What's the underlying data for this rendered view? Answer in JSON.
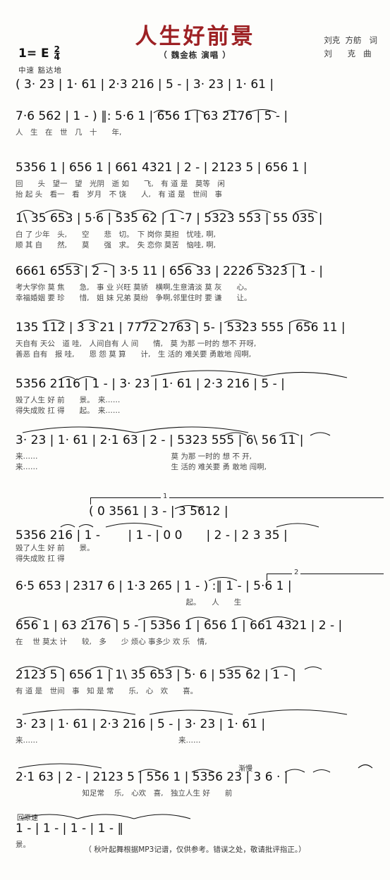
{
  "header": {
    "title": "人生好前景",
    "singer": "（ 魏金栋 演唱 ）",
    "lyricist_row": "刘克  方舫   词",
    "composer_row": "刘      克   曲",
    "key": "1= E",
    "meter_num": "2",
    "meter_den": "4",
    "tempo": "中速 豁达地",
    "title_color": "#9d2124"
  },
  "markings": {
    "rit": "渐慢",
    "a_tempo": "回原速",
    "ending1": "1",
    "ending2": "2"
  },
  "lines": [
    {
      "id": "line-1",
      "notes": "( 3· 23 | 1· 61 | 2·3 216 | 5 - | 3· 23 | 1· 61 |",
      "lyrics": []
    },
    {
      "id": "line-2",
      "notes": "7·6 562 | 1 - ) ‖: 5·6 1 | 656 1 | 63 2176 | 5 - |",
      "lyrics": [
        "人　生　在　世　几　十　　年,"
      ]
    },
    {
      "id": "line-3",
      "notes": "5356 1 | 656 1 | 661 4321 | 2 - | 2123 5 | 656 1 |",
      "lyrics": [
        "回　　头　望一　望　光阴　逝 如　　飞,　有 道 是　莫等　闲",
        "抬 起 头　看一　看　岁月　不 饶　　人,　有 道 是　世间　事"
      ]
    },
    {
      "id": "line-4",
      "notes": "1\\ 35 653 | 5·6 | 535 62 | 1 -7 | 5323 553 | 55 035 |",
      "lyrics": [
        "白 了 少年　头,　　空　　悲　切。　下 岗你 莫担　忧哇, 啊,",
        "顺 其 自　　然,　　莫　　强　求。　失 恋你 莫苦　恼哇, 啊,"
      ]
    },
    {
      "id": "line-5",
      "notes": "6661 6553 | 2 - | 3·5 11 | 656 33 | 2226 5323 | 1 - |",
      "lyrics": [
        "考大学你 莫 焦　　急,　事 业 兴旺 莫骄　横啊,生意清淡 莫 灰　　心。",
        "幸福婚姻 要 珍　　惜,　姐 妹 兄弟 莫纷　争啊,邻里住时 要 谦　　让。"
      ]
    },
    {
      "id": "line-6",
      "notes": "135 112 | 3 3 21 | 7772 2763 | 5- | 5323 555 | 656 11 |",
      "lyrics": [
        "天自有 天公　道 哇,　人间自有 人 间　　情,　莫 为那 一时的 想不 开呀,",
        "善恶 自有　报 哇,　　恩 怨 莫 算　　计,　生 活的 难关要 勇敢地 闯啊,"
      ]
    },
    {
      "id": "line-7",
      "notes": "5356 2116 | 1 - | 3· 23 | 1· 61 | 2·3 216 | 5 - |",
      "lyrics": [
        "毁了人生 好 前　　景。　来……",
        "得失成败 扛 得　　起。　来……"
      ]
    },
    {
      "id": "line-8",
      "notes": "3· 23 | 1· 61 | 2·1 63 | 2 - | 5323 555 | 6\\ 56 11 |",
      "lyrics": [
        "来……　　　　　　　　　　　　　　　　　　莫 为那 一时的 想 不 开,",
        "来……　　　　　　　　　　　　　　　　　　生 活的 难关要 勇 敢地 闯啊,"
      ]
    },
    {
      "id": "line-9-upper",
      "notes": "( 0 3561 | 3 - | 3 5612 |",
      "lyrics": []
    },
    {
      "id": "line-9",
      "notes": "5356 216 | 1 -　　 | 1 - | 0 0　　| 2 - | 2 3 35 |",
      "lyrics": [
        "毁了人生 好 前　　景。",
        "得失成败 扛 得"
      ]
    },
    {
      "id": "line-10",
      "notes": "6·5 653 | 2317 6 | 1·3 265 | 1 - ) :‖ 1 - | 5·6 1 |",
      "lyrics": [
        "　　　　　　　　　　　　　　　　　　　　　　　起。　　人　　生"
      ]
    },
    {
      "id": "line-11",
      "notes": "656 1 | 63 2176 | 5 - | 5356 1 | 656 1 | 661 4321 | 2 - |",
      "lyrics": [
        "在　 世 莫太 计　　较,　多　　少 烦心 事多少 欢 乐　情,"
      ]
    },
    {
      "id": "line-12",
      "notes": "2123 5 | 656 1 | 1\\ 35 653 | 5· 6 | 535 62 | 1 - |",
      "lyrics": [
        "有 道 是　世间　事　知 是 常　　乐,　心　欢　　喜。"
      ]
    },
    {
      "id": "line-13",
      "notes": "3· 23 | 1· 61 | 2·3 216 | 5 - | 3· 23 | 1· 61 |",
      "lyrics": [
        "来……　　　　　　　　　　　　　　　　　　　来……"
      ]
    },
    {
      "id": "line-14",
      "notes": "2·1 63 | 2 - | 2123 5 | 556 1 | 5356 23 | 3 6 · |",
      "lyrics": [
        "　　　　　　　　　知足常　 乐,　心欢　喜,　独立人生 好　　前"
      ]
    },
    {
      "id": "line-15",
      "notes": "1 - | 1 - | 1 - | 1 - ‖",
      "lyrics": [
        "景。"
      ]
    }
  ],
  "footer": "（ 秋叶起舞根据MP3记谱，仅供参考。错误之处，敬请批评指正。）"
}
